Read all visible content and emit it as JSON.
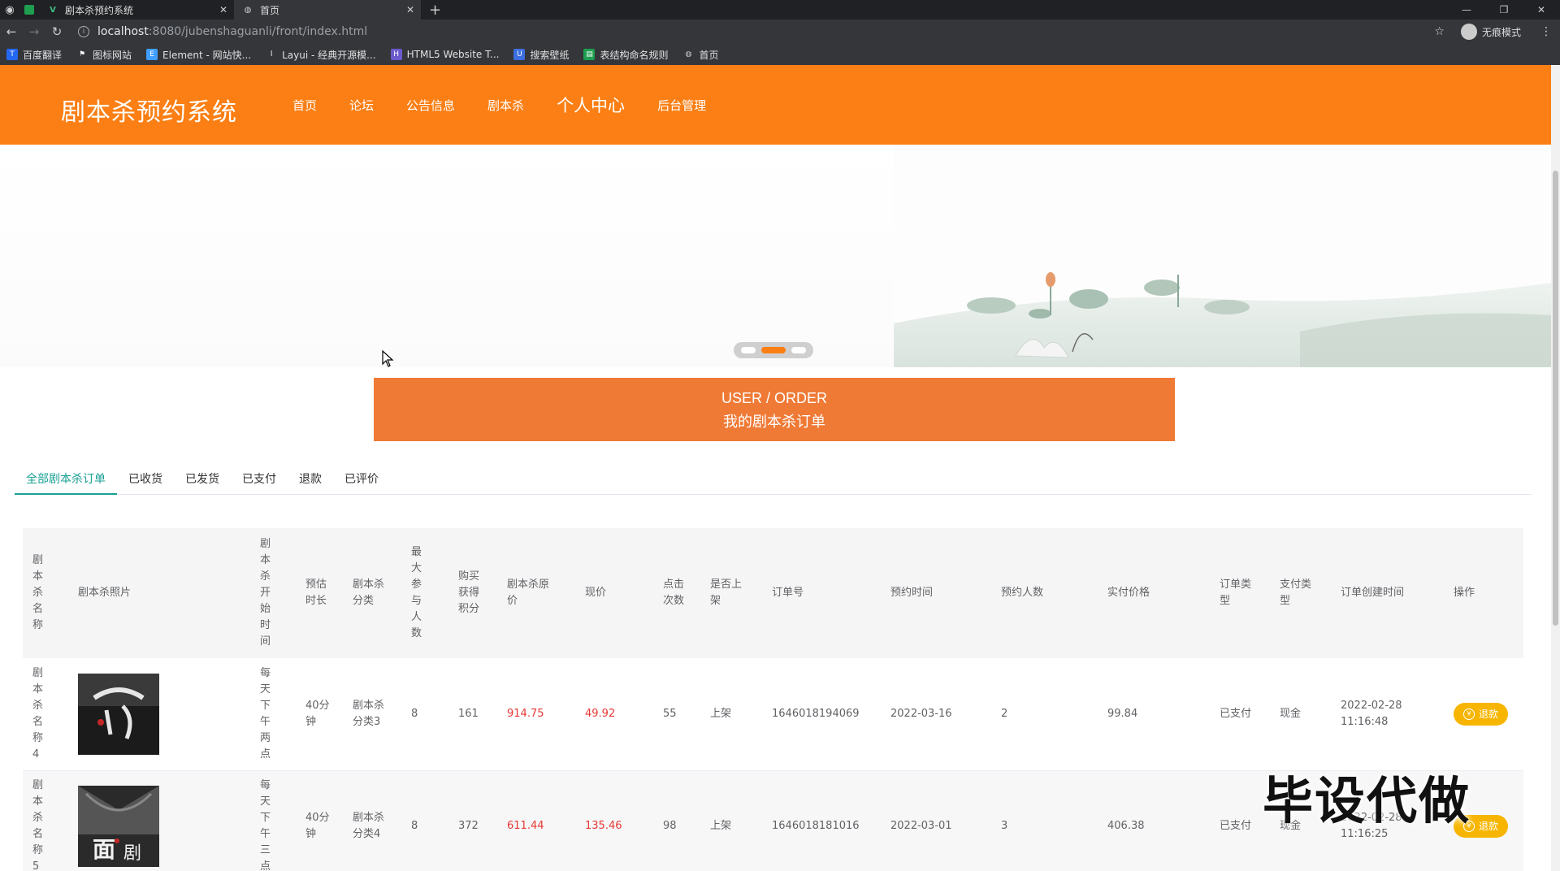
{
  "browser": {
    "tabs": [
      {
        "title": "剧本杀预约系统"
      },
      {
        "title": "首页"
      }
    ],
    "url_host": "localhost",
    "url_rest": ":8080/jubenshaguanli/front/index.html",
    "incognito_label": "无痕模式",
    "bookmarks": [
      "百度翻译",
      "图标网站",
      "Element - 网站快...",
      "Layui - 经典开源模...",
      "HTML5 Website T...",
      "搜索壁纸",
      "表结构命名规则",
      "首页"
    ]
  },
  "header": {
    "logo": "剧本杀预约系统",
    "menu": [
      "首页",
      "论坛",
      "公告信息",
      "剧本杀",
      "个人中心",
      "后台管理"
    ]
  },
  "order_header": {
    "en": "USER / ORDER",
    "cn": "我的剧本杀订单"
  },
  "filter_tabs": [
    "全部剧本杀订单",
    "已收货",
    "已发货",
    "已支付",
    "退款",
    "已评价"
  ],
  "table": {
    "columns": [
      "剧本杀名称",
      "剧本杀照片",
      "剧本杀开始时间",
      "预估时长",
      "剧本杀分类",
      "最大参与人数",
      "购买获得积分",
      "剧本杀原价",
      "现价",
      "点击次数",
      "是否上架",
      "订单号",
      "预约时间",
      "预约人数",
      "实付价格",
      "订单类型",
      "支付类型",
      "订单创建时间",
      "操作"
    ],
    "rows": [
      {
        "name": "剧本杀名称4",
        "start": "每天下午两点",
        "duration": "40分钟",
        "category": "剧本杀分类3",
        "max": "8",
        "points": "161",
        "original": "914.75",
        "price": "49.92",
        "clicks": "55",
        "shelf": "上架",
        "order_no": "1646018194069",
        "book_time": "2022-03-16",
        "people": "2",
        "paid": "99.84",
        "order_type": "已支付",
        "pay_type": "现金",
        "created": "2022-02-28 11:16:48",
        "action": "退款"
      },
      {
        "name": "剧本杀名称5",
        "start": "每天下午三点",
        "duration": "40分钟",
        "category": "剧本杀分类4",
        "max": "8",
        "points": "372",
        "original": "611.44",
        "price": "135.46",
        "clicks": "98",
        "shelf": "上架",
        "order_no": "1646018181016",
        "book_time": "2022-03-01",
        "people": "3",
        "paid": "406.38",
        "order_type": "已支付",
        "pay_type": "现金",
        "created": "2022-02-28 11:16:25",
        "action": "退款"
      }
    ]
  },
  "watermark": "毕设代做",
  "colors": {
    "primary": "#fb7f14",
    "order_header": "#ef7a36",
    "active_tab": "#1aa094",
    "price_red": "#e53935",
    "refund_button": "#f7b500"
  }
}
